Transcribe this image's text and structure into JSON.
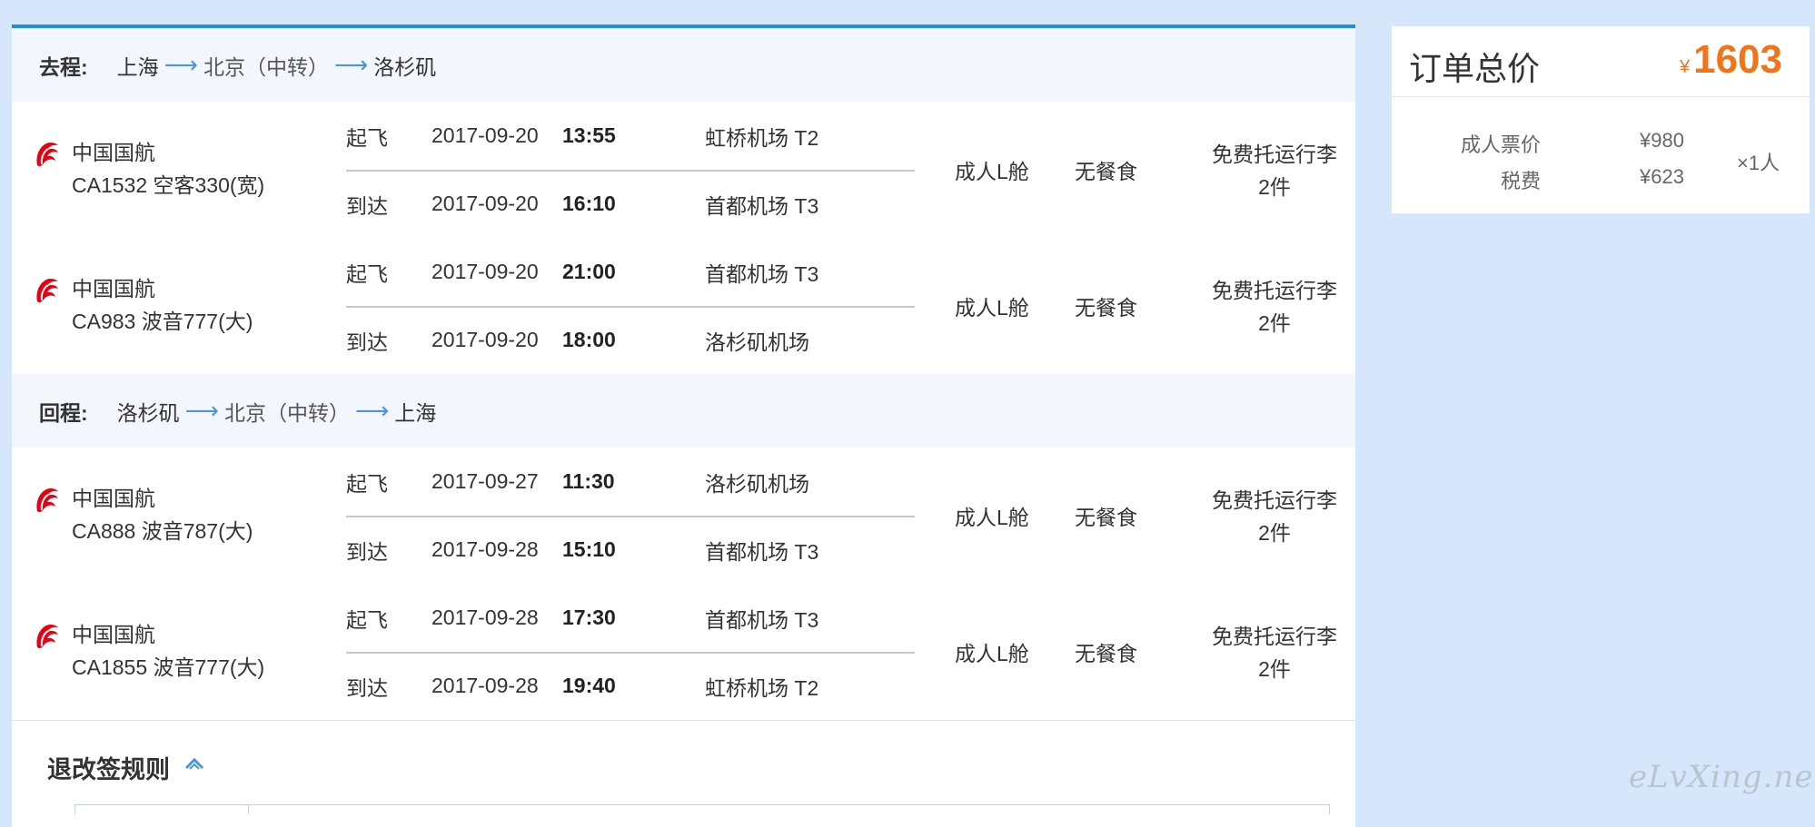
{
  "outbound": {
    "label": "去程:",
    "route": [
      "上海",
      "北京（中转）",
      "洛杉矶"
    ],
    "flights": [
      {
        "airline": "中国国航",
        "flight": "CA1532 空客330(宽)",
        "depart": {
          "type": "起飞",
          "date": "2017-09-20",
          "time": "13:55",
          "airport": "虹桥机场 T2"
        },
        "arrive": {
          "type": "到达",
          "date": "2017-09-20",
          "time": "16:10",
          "airport": "首都机场 T3"
        },
        "cabin": "成人L舱",
        "meal": "无餐食",
        "baggage_line1": "免费托运行李",
        "baggage_line2": "2件"
      },
      {
        "airline": "中国国航",
        "flight": "CA983 波音777(大)",
        "depart": {
          "type": "起飞",
          "date": "2017-09-20",
          "time": "21:00",
          "airport": "首都机场 T3"
        },
        "arrive": {
          "type": "到达",
          "date": "2017-09-20",
          "time": "18:00",
          "airport": "洛杉矶机场"
        },
        "cabin": "成人L舱",
        "meal": "无餐食",
        "baggage_line1": "免费托运行李",
        "baggage_line2": "2件"
      }
    ]
  },
  "return": {
    "label": "回程:",
    "route": [
      "洛杉矶",
      "北京（中转）",
      "上海"
    ],
    "flights": [
      {
        "airline": "中国国航",
        "flight": "CA888 波音787(大)",
        "depart": {
          "type": "起飞",
          "date": "2017-09-27",
          "time": "11:30",
          "airport": "洛杉矶机场"
        },
        "arrive": {
          "type": "到达",
          "date": "2017-09-28",
          "time": "15:10",
          "airport": "首都机场 T3"
        },
        "cabin": "成人L舱",
        "meal": "无餐食",
        "baggage_line1": "免费托运行李",
        "baggage_line2": "2件"
      },
      {
        "airline": "中国国航",
        "flight": "CA1855 波音777(大)",
        "depart": {
          "type": "起飞",
          "date": "2017-09-28",
          "time": "17:30",
          "airport": "首都机场 T3"
        },
        "arrive": {
          "type": "到达",
          "date": "2017-09-28",
          "time": "19:40",
          "airport": "虹桥机场 T2"
        },
        "cabin": "成人L舱",
        "meal": "无餐食",
        "baggage_line1": "免费托运行李",
        "baggage_line2": "2件"
      }
    ]
  },
  "rules": {
    "title": "退改签规则"
  },
  "summary": {
    "title": "订单总价",
    "currency": "¥",
    "total": "1603",
    "adult_fare_label": "成人票价",
    "adult_fare": "¥980",
    "tax_label": "税费",
    "tax": "¥623",
    "quantity": "×1人"
  },
  "watermark": "eLvXing.net",
  "colors": {
    "accent": "#1d90d9",
    "price": "#f27418",
    "airline_logo": "#e60012"
  }
}
